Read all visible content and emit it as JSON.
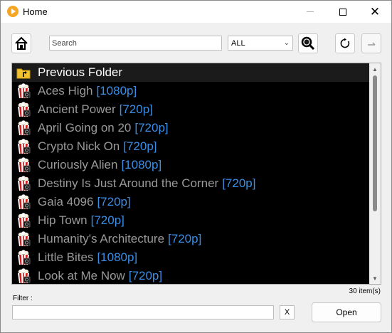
{
  "window": {
    "title": "Home"
  },
  "toolbar": {
    "search_placeholder": "Search",
    "category_selected": "ALL"
  },
  "list": {
    "items": [
      {
        "name": "Previous Folder",
        "res": "",
        "icon": "folder-up-icon"
      },
      {
        "name": "Aces High",
        "res": "[1080p]",
        "icon": "popcorn-icon"
      },
      {
        "name": "Ancient Power",
        "res": "[720p]",
        "icon": "popcorn-icon"
      },
      {
        "name": "April Going on 20",
        "res": "[720p]",
        "icon": "popcorn-icon"
      },
      {
        "name": "Crypto Nick On",
        "res": "[720p]",
        "icon": "popcorn-icon"
      },
      {
        "name": "Curiously Alien",
        "res": "[1080p]",
        "icon": "popcorn-icon"
      },
      {
        "name": "Destiny Is Just Around the Corner",
        "res": "[720p]",
        "icon": "popcorn-icon"
      },
      {
        "name": "Gaia 4096",
        "res": "[720p]",
        "icon": "popcorn-icon"
      },
      {
        "name": "Hip Town",
        "res": "[720p]",
        "icon": "popcorn-icon"
      },
      {
        "name": "Humanity's Architecture",
        "res": "[720p]",
        "icon": "popcorn-icon"
      },
      {
        "name": "Little Bites",
        "res": "[1080p]",
        "icon": "popcorn-icon"
      },
      {
        "name": "Look at Me Now",
        "res": "[720p]",
        "icon": "popcorn-icon"
      }
    ]
  },
  "status": {
    "count": "30 item(s)"
  },
  "footer": {
    "filter_label": "Filter :",
    "clear_label": "X",
    "open_label": "Open"
  },
  "colors": {
    "list_bg": "#000000",
    "item_text": "#9a9a9a",
    "resolution_text": "#3a8ee6",
    "app_icon": "#f5a623"
  }
}
